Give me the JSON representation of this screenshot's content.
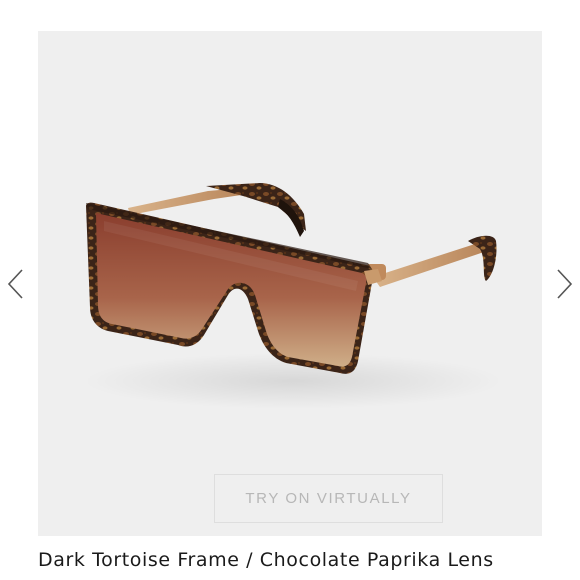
{
  "product": {
    "variant_title": "Dark Tortoise Frame / Chocolate Paprika Lens",
    "image_alt": "sunglasses-photo"
  },
  "gallery": {
    "try_on_label": "TRY ON VIRTUALLY",
    "prev_icon": "chevron-left-icon",
    "next_icon": "chevron-right-icon"
  },
  "colors": {
    "gallery_background": "#efefef",
    "lens_top": "#8a3e2e",
    "lens_bottom": "#c9a27c",
    "frame_gold": "#c99a6c",
    "tortoise": "#3b2418"
  }
}
